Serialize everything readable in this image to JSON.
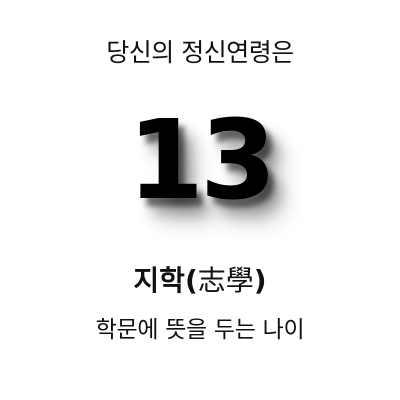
{
  "result": {
    "intro": "당신의 정신연령은",
    "age": "13",
    "term_korean": "지학",
    "term_open_paren": "(",
    "term_hanja": "志學",
    "term_close_paren": ")",
    "meaning": "학문에 뜻을 두는 나이"
  }
}
